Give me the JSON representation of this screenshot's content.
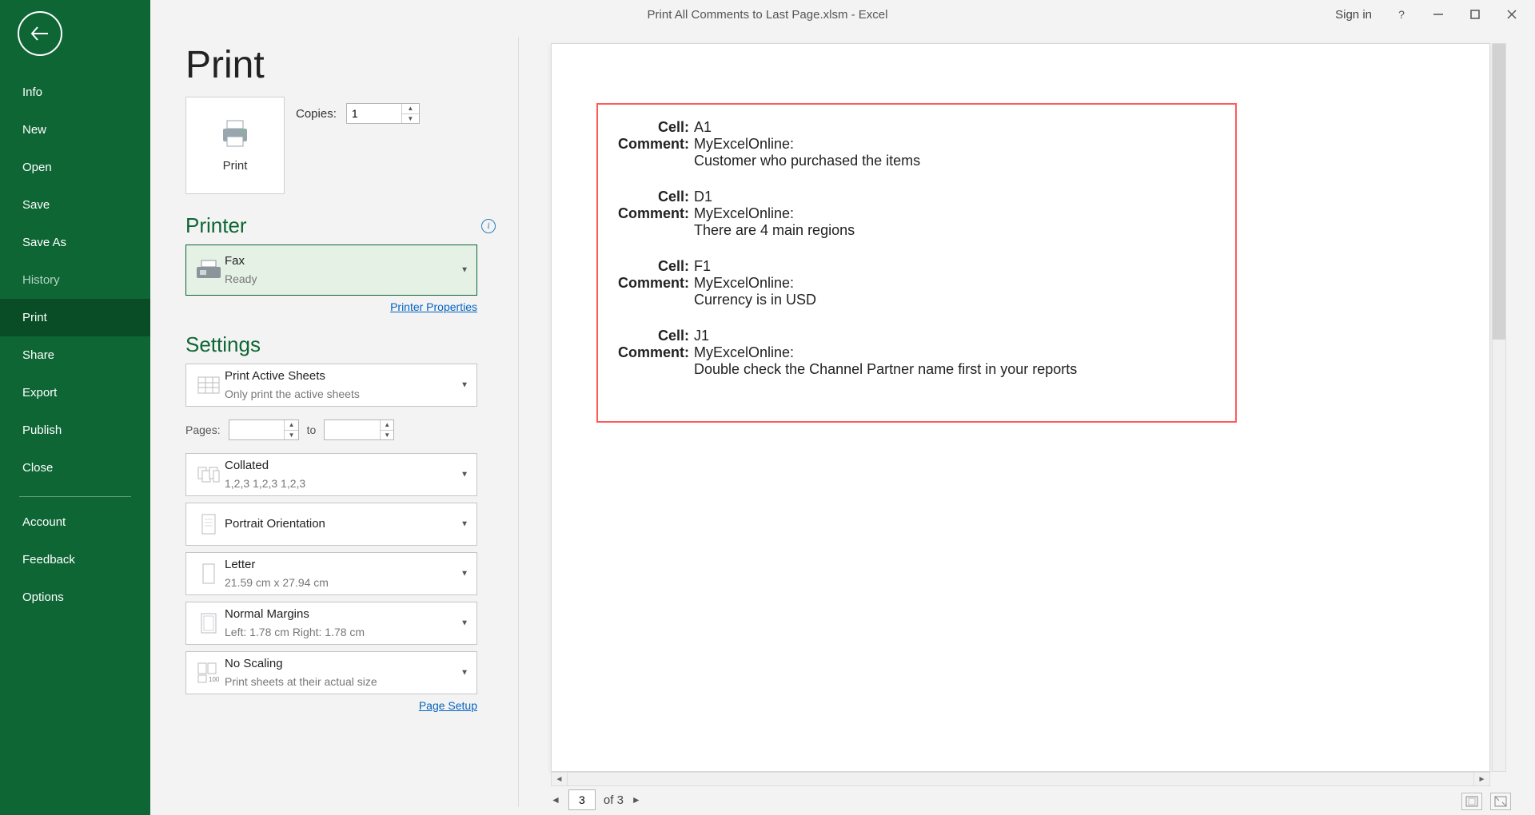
{
  "titlebar": {
    "title": "Print All Comments to Last Page.xlsm  -  Excel",
    "signin": "Sign in"
  },
  "sidebar": {
    "items": [
      {
        "label": "Info"
      },
      {
        "label": "New"
      },
      {
        "label": "Open"
      },
      {
        "label": "Save"
      },
      {
        "label": "Save As"
      },
      {
        "label": "History"
      },
      {
        "label": "Print"
      },
      {
        "label": "Share"
      },
      {
        "label": "Export"
      },
      {
        "label": "Publish"
      },
      {
        "label": "Close"
      }
    ],
    "bottom": {
      "account": "Account",
      "feedback": "Feedback",
      "options": "Options"
    }
  },
  "print": {
    "title": "Print",
    "button_label": "Print",
    "copies_label": "Copies:",
    "copies_value": "1",
    "printer_section": "Printer",
    "printer_name": "Fax",
    "printer_status": "Ready",
    "printer_properties": "Printer Properties",
    "settings_section": "Settings",
    "what_to_print": {
      "line1": "Print Active Sheets",
      "line2": "Only print the active sheets"
    },
    "pages_label": "Pages:",
    "pages_to": "to",
    "collation": {
      "line1": "Collated",
      "line2": "1,2,3     1,2,3     1,2,3"
    },
    "orientation": {
      "line1": "Portrait Orientation",
      "line2": ""
    },
    "paper": {
      "line1": "Letter",
      "line2": "21.59 cm x 27.94 cm"
    },
    "margins": {
      "line1": "Normal Margins",
      "line2": "Left:  1.78 cm    Right:  1.78 cm"
    },
    "scaling": {
      "line1": "No Scaling",
      "line2": "Print sheets at their actual size"
    },
    "page_setup": "Page Setup"
  },
  "preview": {
    "comments": [
      {
        "cell": "A1",
        "author": "MyExcelOnline:",
        "text": "Customer who purchased the items"
      },
      {
        "cell": "D1",
        "author": "MyExcelOnline:",
        "text": "There are 4 main regions"
      },
      {
        "cell": "F1",
        "author": "MyExcelOnline:",
        "text": "Currency is in USD"
      },
      {
        "cell": "J1",
        "author": "MyExcelOnline:",
        "text": "Double check the Channel Partner name first in your reports"
      }
    ],
    "field_cell": "Cell:",
    "field_comment": "Comment:"
  },
  "pagenav": {
    "current": "3",
    "total": "of 3"
  }
}
